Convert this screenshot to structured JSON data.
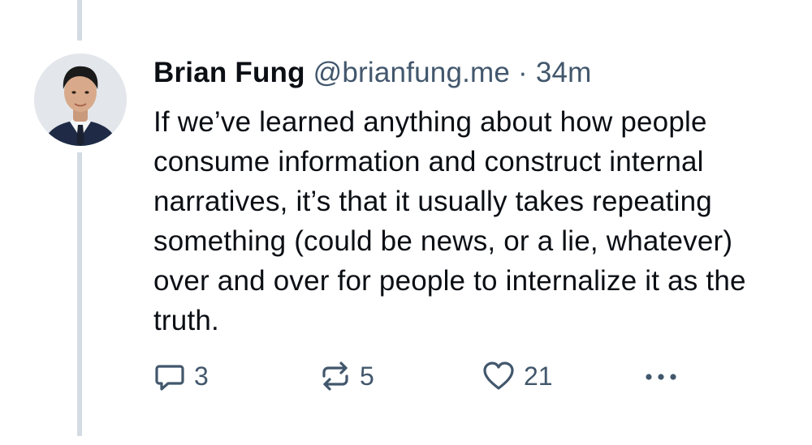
{
  "post": {
    "author_name": "Brian Fung",
    "handle": "@brianfung.me",
    "separator": "·",
    "timestamp": "34m",
    "text": "If we’ve learned anything about how people consume information and construct internal narratives, it’s that it usually takes repeating something (could be news, or a lie, whatever) over and over for people to internalize it as the truth."
  },
  "actions": {
    "reply_count": "3",
    "repost_count": "5",
    "like_count": "21"
  },
  "icons": {
    "reply": "speech-bubble-icon",
    "repost": "repost-arrows-icon",
    "like": "heart-icon",
    "more": "ellipsis-icon"
  },
  "colors": {
    "text": "#0b0f14",
    "muted": "#42576c",
    "thread_line": "#d4dbe2"
  }
}
